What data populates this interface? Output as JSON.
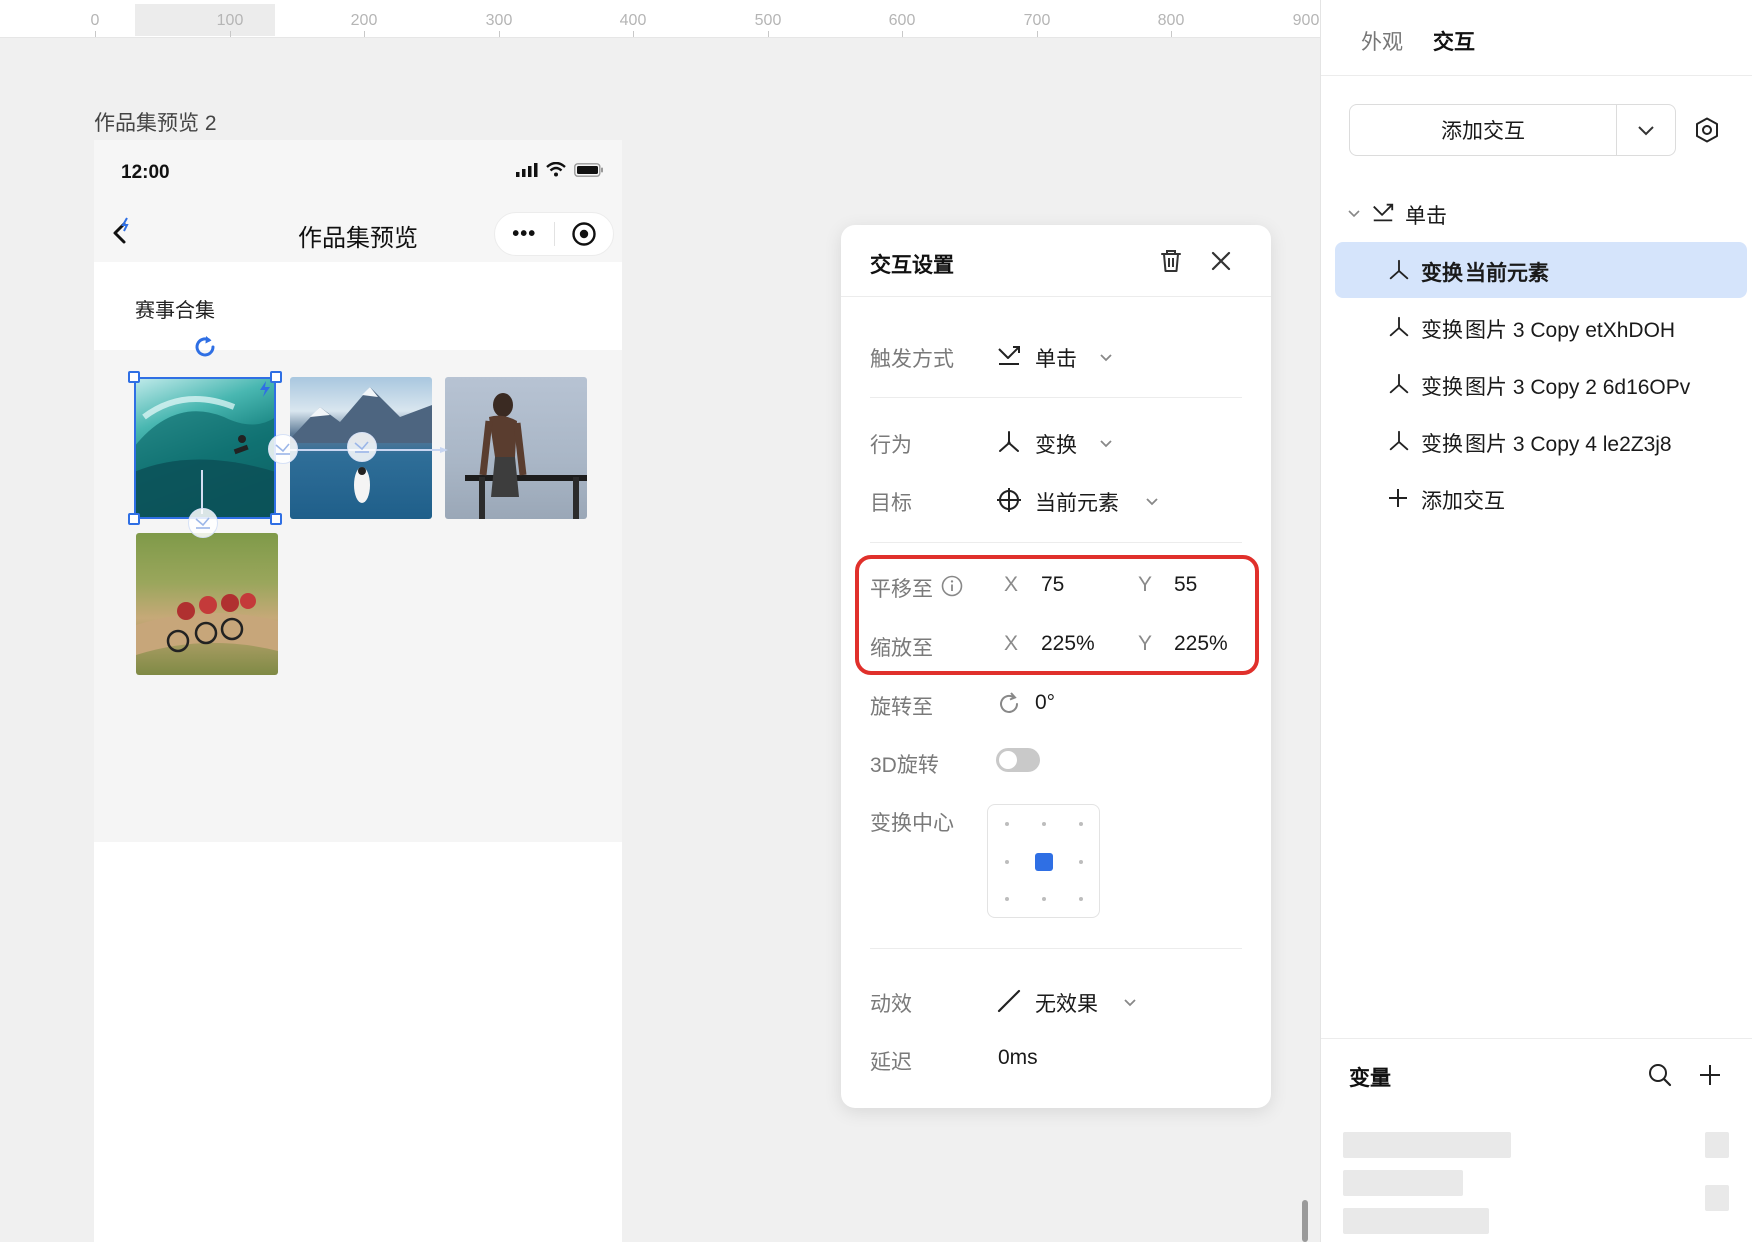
{
  "ruler": {
    "ticks": [
      "0",
      "100",
      "200",
      "300",
      "400",
      "500",
      "600",
      "700",
      "800",
      "900"
    ]
  },
  "canvas": {
    "frame_label": "作品集预览 2"
  },
  "phone": {
    "status_time": "12:00",
    "nav_title": "作品集预览",
    "nav_more": "•••",
    "header_title": "赛事合集",
    "gallery": [
      {
        "subject": "surfer riding a wave"
      },
      {
        "subject": "paddler on a mountain lake"
      },
      {
        "subject": "athlete doing bar dips"
      },
      {
        "subject": "group of road cyclists"
      }
    ]
  },
  "dialog": {
    "title": "交互设置",
    "trigger": {
      "label": "触发方式",
      "value": "单击"
    },
    "behavior": {
      "label": "行为",
      "value": "变换"
    },
    "target": {
      "label": "目标",
      "value": "当前元素"
    },
    "translate": {
      "label": "平移至",
      "x_axis": "X",
      "x": "75",
      "y_axis": "Y",
      "y": "55"
    },
    "scale": {
      "label": "缩放至",
      "x_axis": "X",
      "x": "225%",
      "y_axis": "Y",
      "y": "225%"
    },
    "rotate": {
      "label": "旋转至",
      "value": "0°"
    },
    "rotate3d": {
      "label": "3D旋转",
      "enabled": false
    },
    "origin": {
      "label": "变换中心",
      "selected": "center"
    },
    "effect": {
      "label": "动效",
      "value": "无效果"
    },
    "delay": {
      "label": "延迟",
      "value": "0ms"
    },
    "highlight_color": "#e0302b"
  },
  "panel": {
    "tabs": [
      {
        "label": "外观",
        "active": false
      },
      {
        "label": "交互",
        "active": true
      }
    ],
    "add_interaction": "添加交互",
    "tree": {
      "event": "单击",
      "actions": [
        {
          "verb": "变换",
          "target": "当前元素",
          "selected": true
        },
        {
          "verb": "变换",
          "target": "图片 3 Copy etXhDOH",
          "selected": false
        },
        {
          "verb": "变换",
          "target": "图片 3 Copy 2 6d16OPv",
          "selected": false
        },
        {
          "verb": "变换",
          "target": "图片 3 Copy 4 le2Z3j8",
          "selected": false
        }
      ],
      "add_label": "添加交互"
    },
    "variables_title": "变量",
    "accent_color": "#2f6fe4",
    "selected_row_color": "#d5e4fb"
  }
}
